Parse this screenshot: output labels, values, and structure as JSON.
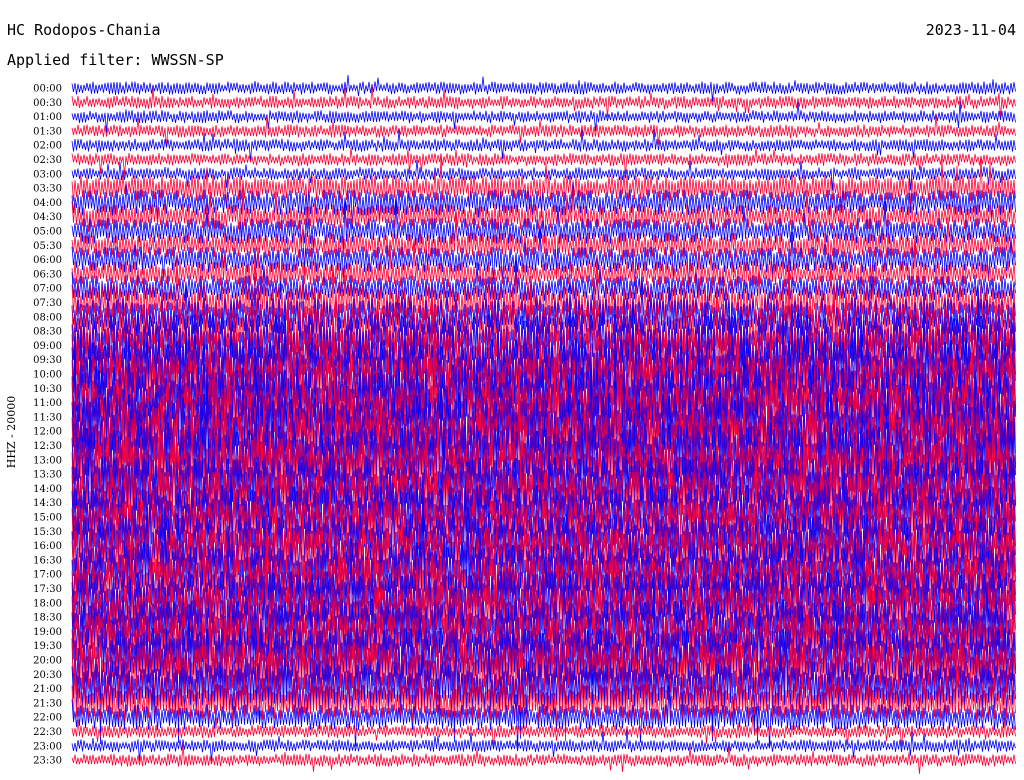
{
  "header": {
    "station": "HC Rodopos-Chania",
    "date": "2023-11-04",
    "filter": "Applied filter: WWSSN-SP"
  },
  "colors": {
    "trace_a": "#0000ff",
    "trace_b": "#ff0033",
    "background": "#ffffff"
  },
  "chart_data": {
    "type": "line",
    "title": "HC Rodopos-Chania",
    "ylabel": "HHZ - 20000",
    "xlabel": "",
    "row_labels": [
      "00:00",
      "00:30",
      "01:00",
      "01:30",
      "02:00",
      "02:30",
      "03:00",
      "03:30",
      "04:00",
      "04:30",
      "05:00",
      "05:30",
      "06:00",
      "06:30",
      "07:00",
      "07:30",
      "08:00",
      "08:30",
      "09:00",
      "09:30",
      "10:00",
      "10:30",
      "11:00",
      "11:30",
      "12:00",
      "12:30",
      "13:00",
      "13:30",
      "14:00",
      "14:30",
      "15:00",
      "15:30",
      "16:00",
      "16:30",
      "17:00",
      "17:30",
      "18:00",
      "18:30",
      "19:00",
      "19:30",
      "20:00",
      "20:30",
      "21:00",
      "21:30",
      "22:00",
      "22:30",
      "23:00",
      "23:30"
    ],
    "series": [
      {
        "values": [
          1,
          1,
          1,
          1,
          1,
          1,
          1,
          2,
          2,
          2,
          2,
          2,
          2,
          2,
          2,
          3,
          3,
          4,
          5,
          5,
          6,
          6,
          6,
          6,
          6,
          6,
          6,
          6,
          5,
          5,
          5,
          5,
          5,
          5,
          5,
          5,
          5,
          5,
          5,
          5,
          5,
          5,
          4,
          3,
          2,
          1,
          1,
          1
        ]
      }
    ]
  }
}
